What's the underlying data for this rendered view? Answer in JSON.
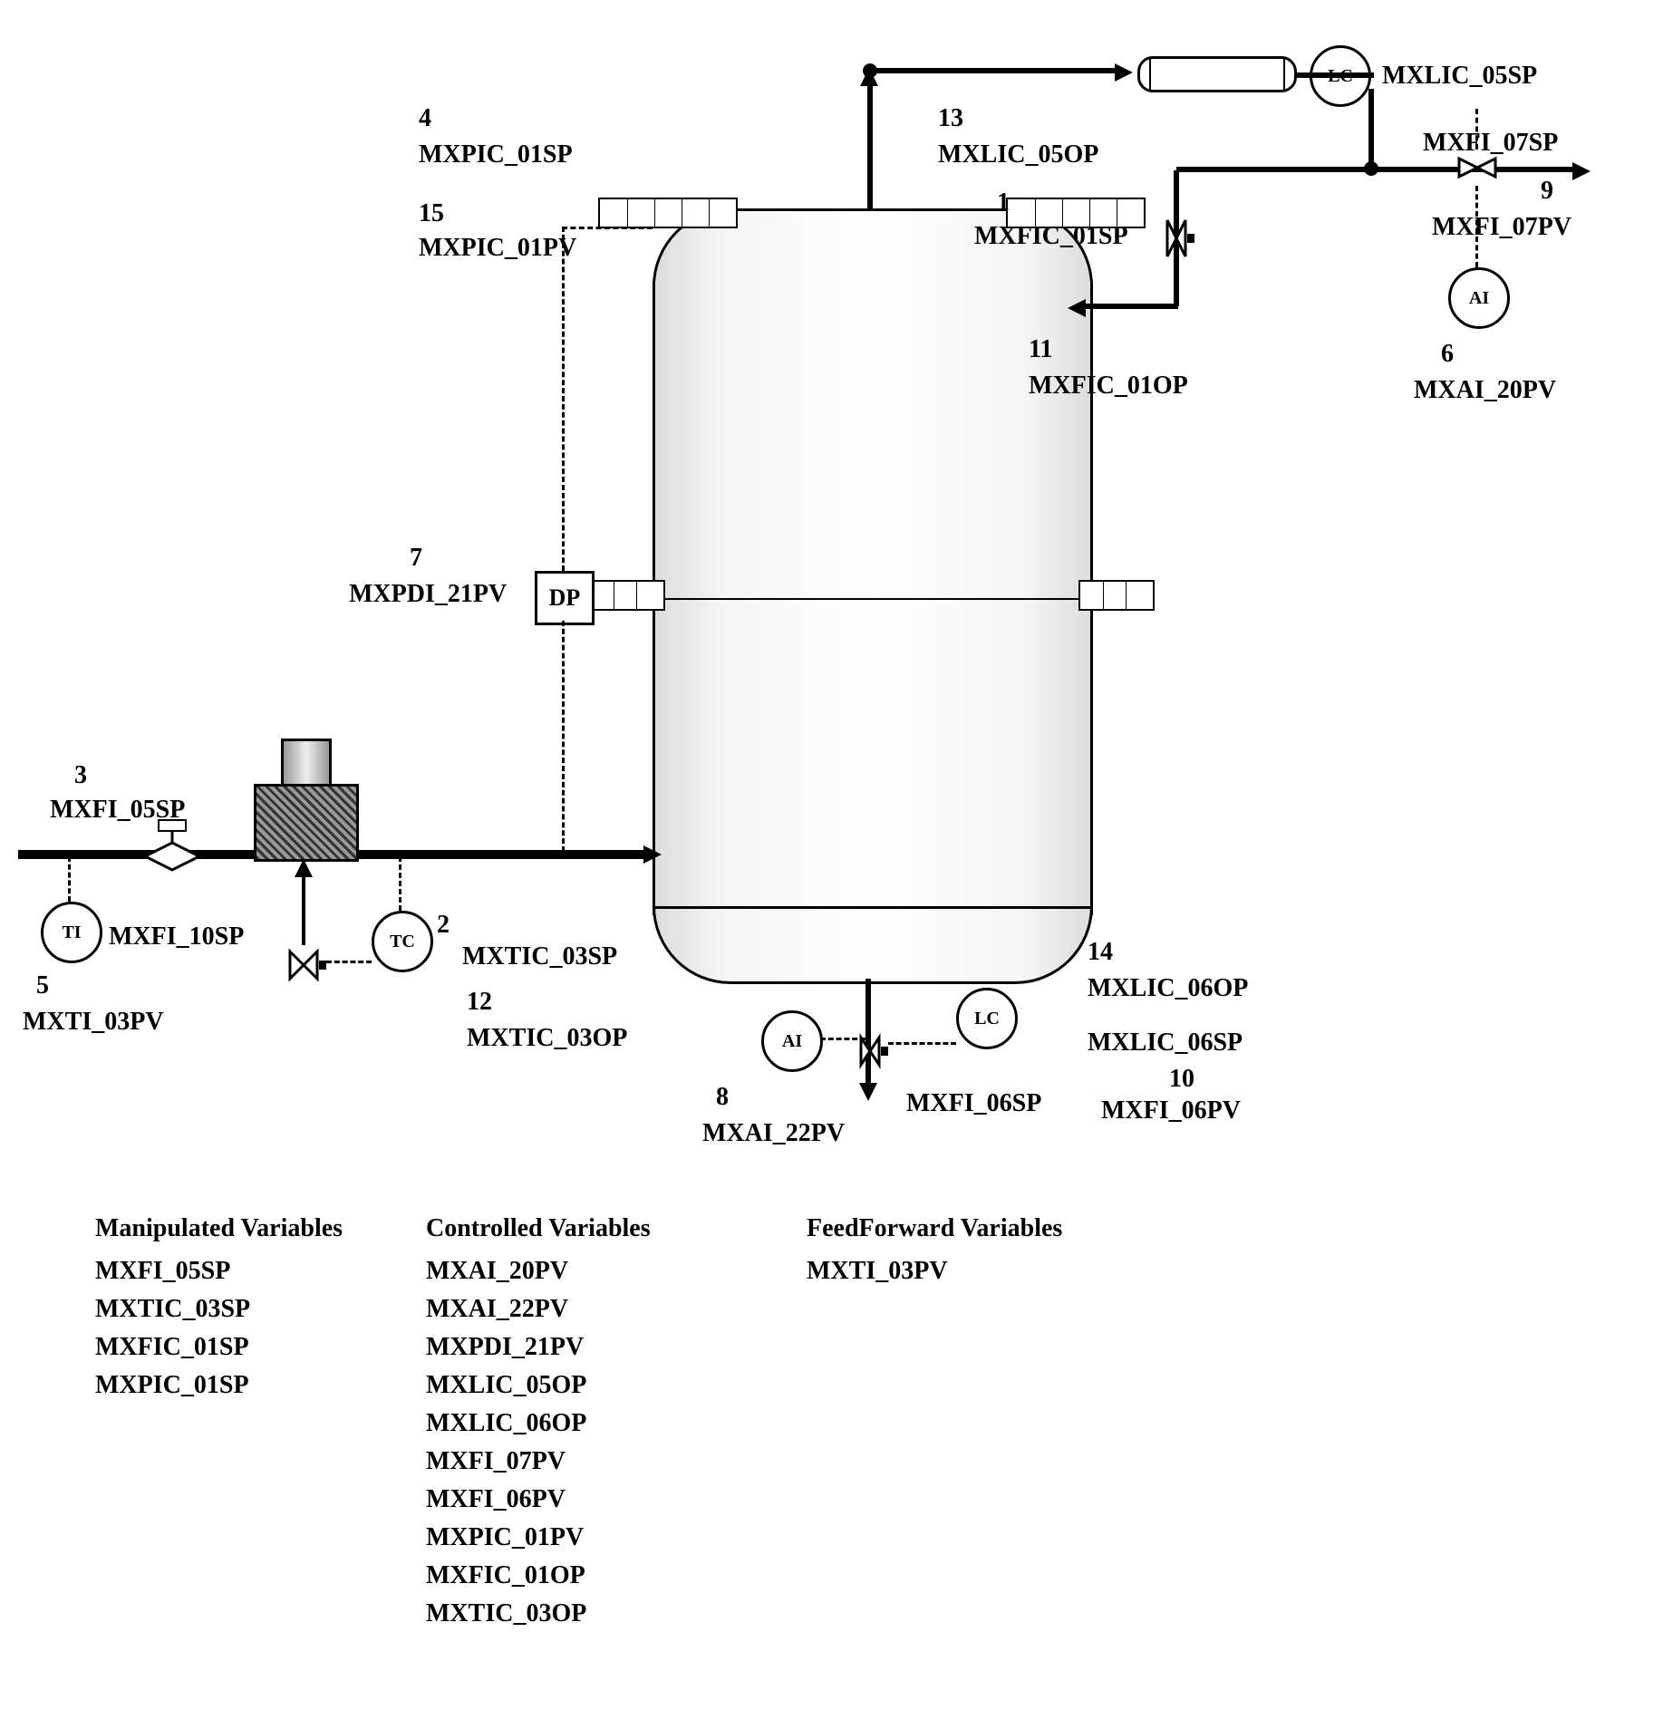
{
  "tags": {
    "t1": {
      "num": "1",
      "name": "MXFIC_01SP"
    },
    "t2": {
      "num": "2",
      "name": "MXTIC_03SP"
    },
    "t3": {
      "num": "3",
      "name": "MXFI_05SP"
    },
    "t4": {
      "num": "4",
      "name": "MXPIC_01SP"
    },
    "t5": {
      "num": "5",
      "name": "MXTI_03PV"
    },
    "t6": {
      "num": "6",
      "name": "MXAI_20PV"
    },
    "t7": {
      "num": "7",
      "name": "MXPDI_21PV"
    },
    "t8": {
      "num": "8",
      "name": "MXAI_22PV"
    },
    "t9": {
      "num": "9",
      "name": "MXFI_07PV"
    },
    "t10": {
      "num": "10",
      "name": "MXFI_06PV"
    },
    "t11": {
      "num": "11",
      "name": "MXFIC_01OP"
    },
    "t12": {
      "num": "12",
      "name": "MXTIC_03OP"
    },
    "t13": {
      "num": "13",
      "name": "MXLIC_05OP"
    },
    "t14": {
      "num": "14",
      "name": "MXLIC_06OP"
    },
    "t15": {
      "num": "15",
      "name": "MXPIC_01PV"
    },
    "mxfi_10sp": "MXFI_10SP",
    "mxfi_07sp": "MXFI_07SP",
    "mxfi_06sp": "MXFI_06SP",
    "mxlic_05sp": "MXLIC_05SP",
    "mxlic_06sp": "MXLIC_06SP"
  },
  "instruments": {
    "ti": "TI",
    "tc": "TC",
    "dp": "DP",
    "ai_top": "AI",
    "ai_bottom": "AI",
    "lc_top": "LC",
    "lc_bottom": "LC"
  },
  "legend": {
    "manipulated": {
      "title": "Manipulated Variables",
      "items": [
        "MXFI_05SP",
        "MXTIC_03SP",
        "MXFIC_01SP",
        "MXPIC_01SP"
      ]
    },
    "controlled": {
      "title": "Controlled Variables",
      "items": [
        "MXAI_20PV",
        "MXAI_22PV",
        "MXPDI_21PV",
        "MXLIC_05OP",
        "MXLIC_06OP",
        "MXFI_07PV",
        "MXFI_06PV",
        "MXPIC_01PV",
        "MXFIC_01OP",
        "MXTIC_03OP"
      ]
    },
    "feedforward": {
      "title": "FeedForward Variables",
      "items": [
        "MXTI_03PV"
      ]
    }
  }
}
